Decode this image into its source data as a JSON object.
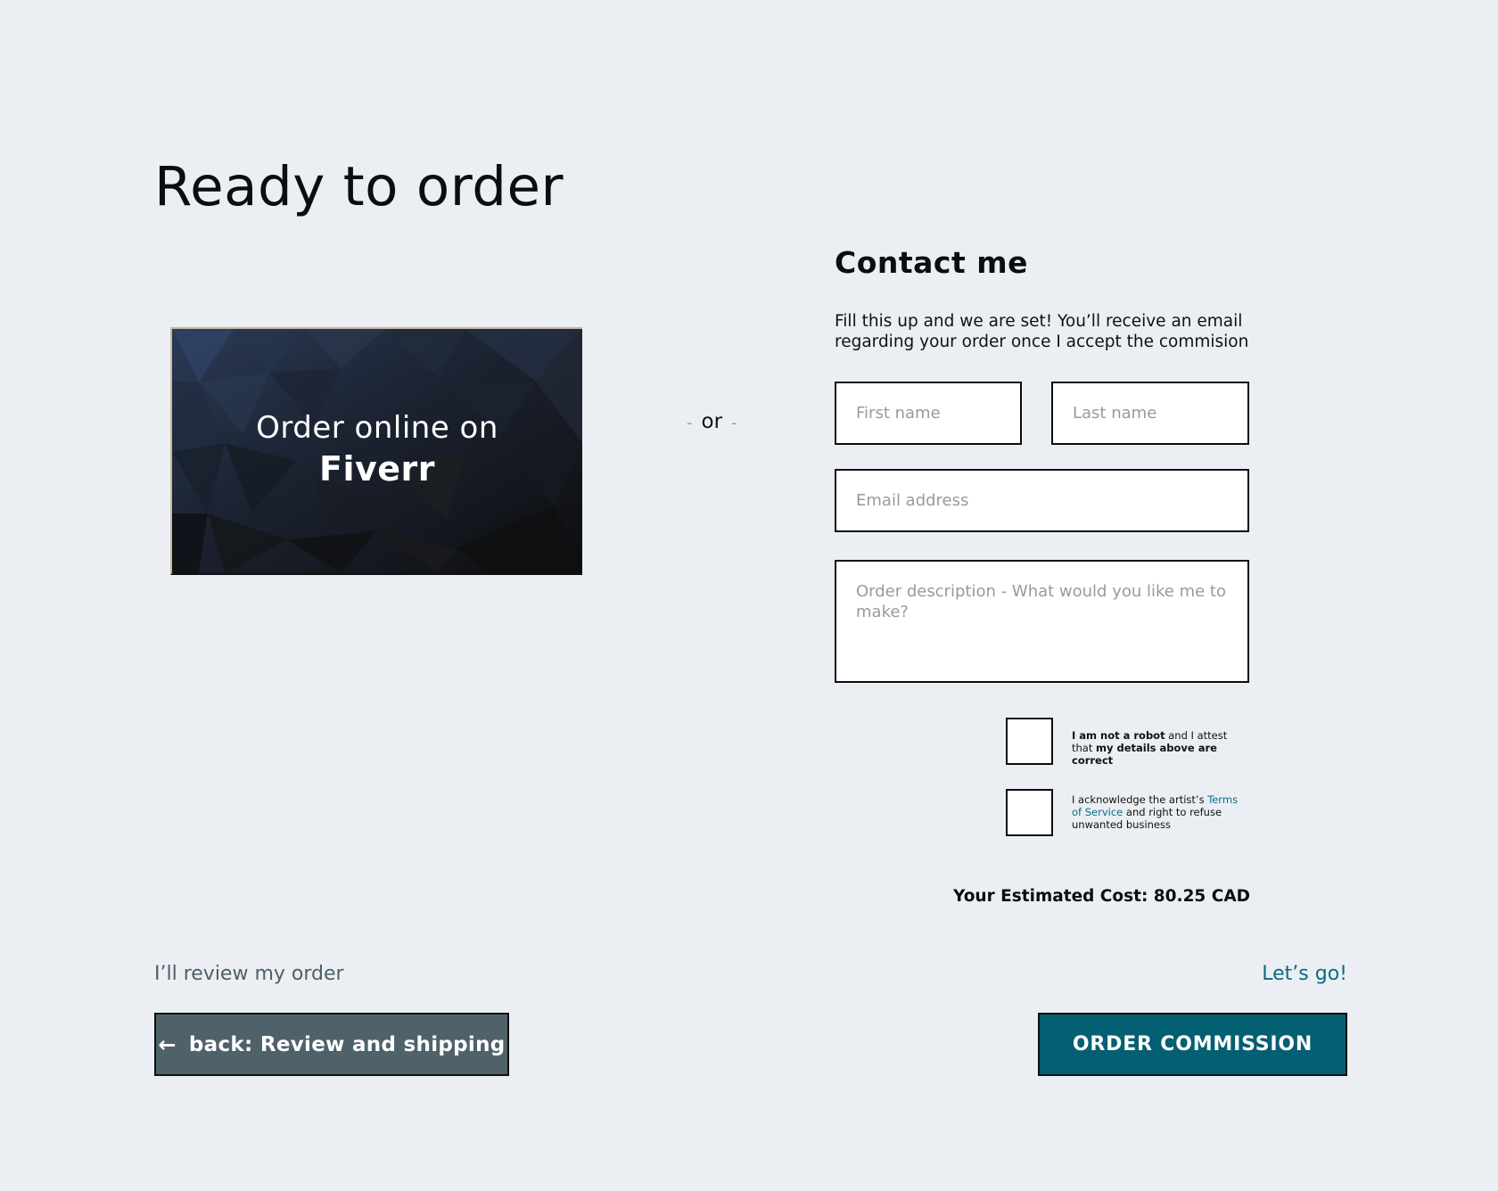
{
  "page": {
    "title": "Ready to order"
  },
  "fiverr": {
    "line1": "Order online on",
    "line2": "Fiverr"
  },
  "separator": {
    "dash_left": "-",
    "text": "or",
    "dash_right": "-"
  },
  "contact": {
    "title": "Contact me",
    "description": "Fill this up and we are set! You’ll receive an email regarding your order once I accept the commision",
    "first_name_placeholder": "First name",
    "last_name_placeholder": "Last name",
    "email_placeholder": "Email address",
    "description_placeholder": "Order description - What would you like me to make?",
    "robot_bold": "I am not a robot",
    "robot_mid": " and I attest that ",
    "robot_end": "my details above are correct",
    "tos_pre": "I acknowledge the artist’s ",
    "tos_link": "Terms of Service",
    "tos_post": " and right to refuse unwanted business",
    "estimate": "Your Estimated Cost: 80.25 CAD"
  },
  "footer": {
    "review_label": "I’ll review my order",
    "go_label": "Let’s go!",
    "back_arrow": "←",
    "back_button": "back: Review and shipping",
    "order_button": "ORDER COMMISSION"
  },
  "colors": {
    "background": "#ebeff4",
    "accent": "#055f73",
    "back_button": "#4f6269",
    "link": "#0b6b80"
  }
}
